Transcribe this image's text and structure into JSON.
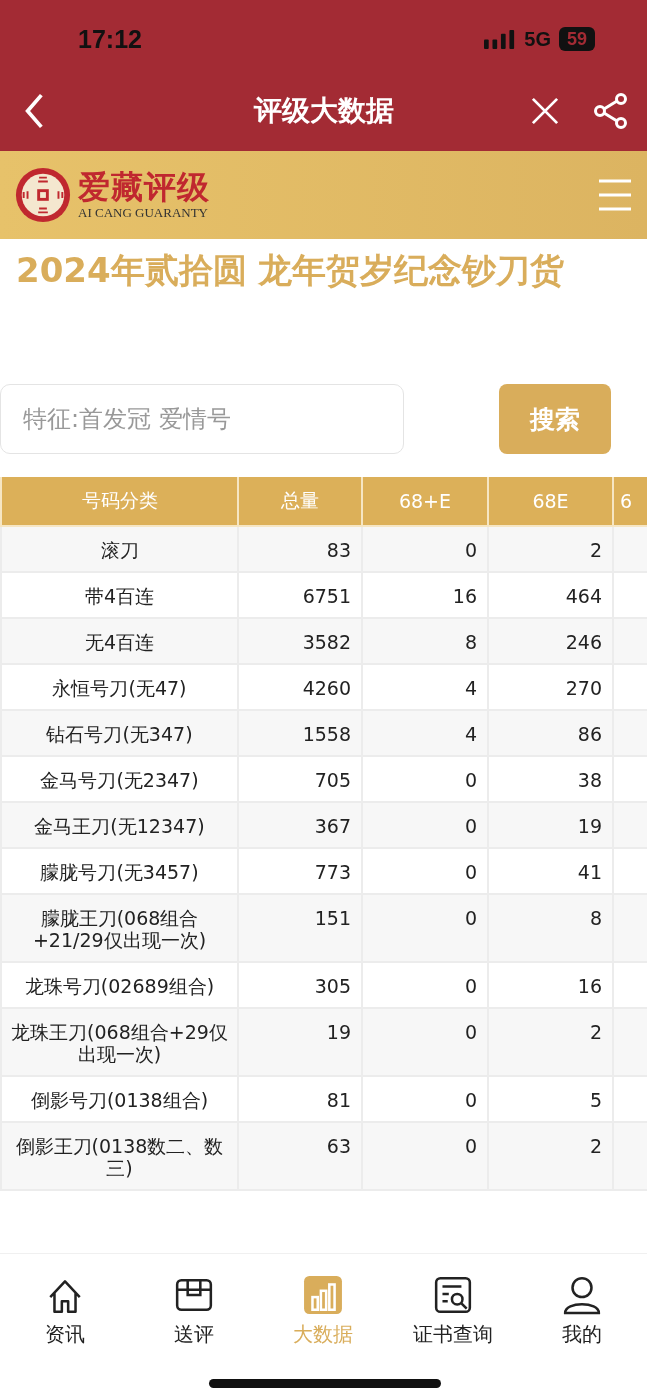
{
  "status_bar": {
    "time": "17:12",
    "network": "5G",
    "battery": "59"
  },
  "nav_bar": {
    "title": "评级大数据"
  },
  "brand": {
    "name": "爱藏评级",
    "tagline": "AI CANG GUARANTY"
  },
  "page_title": "2024年贰拾圆 龙年贺岁纪念钞刀货",
  "search": {
    "placeholder": "特征:首发冠 爱情号",
    "button": "搜索"
  },
  "table": {
    "columns": [
      "号码分类",
      "总量",
      "68+E",
      "68E",
      "6"
    ],
    "rows": [
      [
        "滚刀",
        "83",
        "0",
        "2"
      ],
      [
        "带4百连",
        "6751",
        "16",
        "464"
      ],
      [
        "无4百连",
        "3582",
        "8",
        "246"
      ],
      [
        "永恒号刀(无47)",
        "4260",
        "4",
        "270"
      ],
      [
        "钻石号刀(无347)",
        "1558",
        "4",
        "86"
      ],
      [
        "金马号刀(无2347)",
        "705",
        "0",
        "38"
      ],
      [
        "金马王刀(无12347)",
        "367",
        "0",
        "19"
      ],
      [
        "朦胧号刀(无3457)",
        "773",
        "0",
        "41"
      ],
      [
        "朦胧王刀(068组合+21/29仅出现一次)",
        "151",
        "0",
        "8"
      ],
      [
        "龙珠号刀(02689组合)",
        "305",
        "0",
        "16"
      ],
      [
        "龙珠王刀(068组合+29仅出现一次)",
        "19",
        "0",
        "2"
      ],
      [
        "倒影号刀(0138组合)",
        "81",
        "0",
        "5"
      ],
      [
        "倒影王刀(0138数二、数三)",
        "63",
        "0",
        "2"
      ]
    ]
  },
  "tab_bar": [
    {
      "label": "资讯",
      "kind": "home",
      "selected": false
    },
    {
      "label": "送评",
      "kind": "box",
      "selected": false
    },
    {
      "label": "大数据",
      "kind": "chart",
      "selected": true
    },
    {
      "label": "证书查询",
      "kind": "certificate",
      "selected": false
    },
    {
      "label": "我的",
      "kind": "user",
      "selected": false
    }
  ]
}
